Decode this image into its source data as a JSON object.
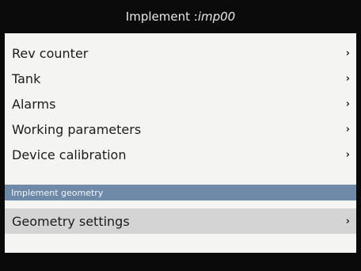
{
  "title": {
    "prefix": "Implement : ",
    "name": "imp00"
  },
  "menu": {
    "items": [
      {
        "label": "Rev counter",
        "chevron": "›"
      },
      {
        "label": "Tank",
        "chevron": "›"
      },
      {
        "label": "Alarms",
        "chevron": "›"
      },
      {
        "label": "Working parameters",
        "chevron": "›"
      },
      {
        "label": "Device calibration",
        "chevron": "›"
      }
    ]
  },
  "section": {
    "header": "Implement geometry",
    "items": [
      {
        "label": "Geometry settings",
        "chevron": "›"
      }
    ]
  },
  "colors": {
    "section_header_bg": "#6f8aa8",
    "selected_row_bg": "#d4d4d4",
    "panel_bg": "#f4f4f3"
  },
  "icons": {
    "chevron": "chevron-right-icon"
  }
}
